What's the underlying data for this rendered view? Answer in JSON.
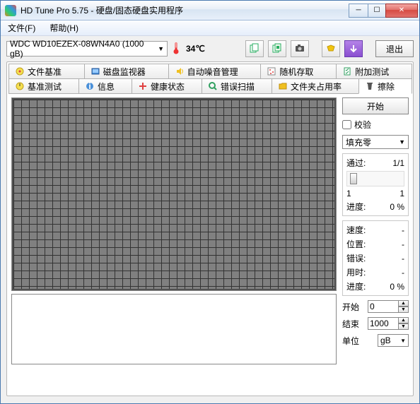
{
  "window": {
    "title": "HD Tune Pro 5.75 - 硬盘/固态硬盘实用程序"
  },
  "menu": {
    "file": "文件(F)",
    "help": "帮助(H)"
  },
  "toolbar": {
    "drive": "WDC WD10EZEX-08WN4A0 (1000 gB)",
    "temp": "34℃",
    "exit": "退出"
  },
  "tabs": {
    "row1": [
      {
        "label": "文件基准"
      },
      {
        "label": "磁盘监视器"
      },
      {
        "label": "自动噪音管理"
      },
      {
        "label": "随机存取"
      },
      {
        "label": "附加测试"
      }
    ],
    "row2": [
      {
        "label": "基准测试"
      },
      {
        "label": "信息"
      },
      {
        "label": "健康状态"
      },
      {
        "label": "错误扫描"
      },
      {
        "label": "文件夹占用率"
      },
      {
        "label": "擦除"
      }
    ]
  },
  "erase": {
    "start_btn": "开始",
    "verify": "校验",
    "method": "填充零",
    "pass_label": "通过:",
    "pass_value": "1/1",
    "range_min": "1",
    "range_max": "1",
    "progress_label": "进度:",
    "progress_value": "0 %",
    "speed_label": "速度:",
    "speed_value": "-",
    "position_label": "位置:",
    "position_value": "-",
    "errors_label": "错误:",
    "errors_value": "-",
    "elapsed_label": "用时:",
    "elapsed_value": "-",
    "progress2_label": "进度:",
    "progress2_value": "0 %",
    "start_label": "开始",
    "start_value": "0",
    "end_label": "结束",
    "end_value": "1000",
    "unit_label": "单位",
    "unit_value": "gB"
  }
}
